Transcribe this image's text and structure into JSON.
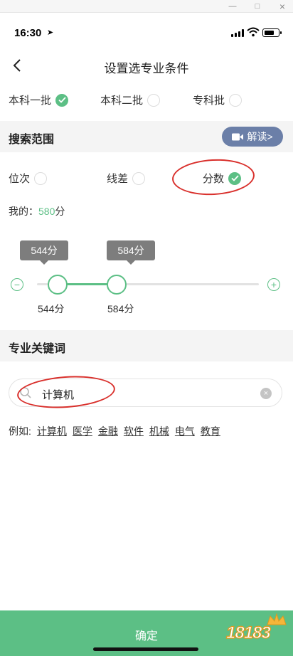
{
  "window": {
    "minimize": "—",
    "maximize": "□",
    "close": "×"
  },
  "status": {
    "time": "16:30",
    "location_arrow": "➤",
    "battery_level": 0.7
  },
  "nav": {
    "title": "设置选专业条件"
  },
  "batches": [
    {
      "label": "本科一批",
      "selected": true
    },
    {
      "label": "本科二批",
      "selected": false
    },
    {
      "label": "专科批",
      "selected": false
    }
  ],
  "search_range": {
    "title": "搜索范围",
    "explain_label": "解读>",
    "options": [
      {
        "label": "位次",
        "selected": false
      },
      {
        "label": "线差",
        "selected": false
      },
      {
        "label": "分数",
        "selected": true
      }
    ],
    "mine_prefix": "我的：",
    "mine_value": "580",
    "mine_unit": "分"
  },
  "slider": {
    "low_bubble": "544分",
    "high_bubble": "584分",
    "low_label": "544分",
    "high_label": "584分",
    "minus": "−",
    "plus": "+"
  },
  "keyword": {
    "title": "专业关键词",
    "search_value": "计算机",
    "clear": "×",
    "examples_prefix": "例如:",
    "examples": [
      "计算机",
      "医学",
      "金融",
      "软件",
      "机械",
      "电气",
      "教育"
    ]
  },
  "footer": {
    "confirm_label": "确定"
  },
  "watermark": {
    "text": "18183"
  },
  "colors": {
    "accent": "#5cbf85",
    "explain_bg": "#6b7fa8",
    "annotation": "#d9302c",
    "tooltip": "#7d7d7d"
  }
}
